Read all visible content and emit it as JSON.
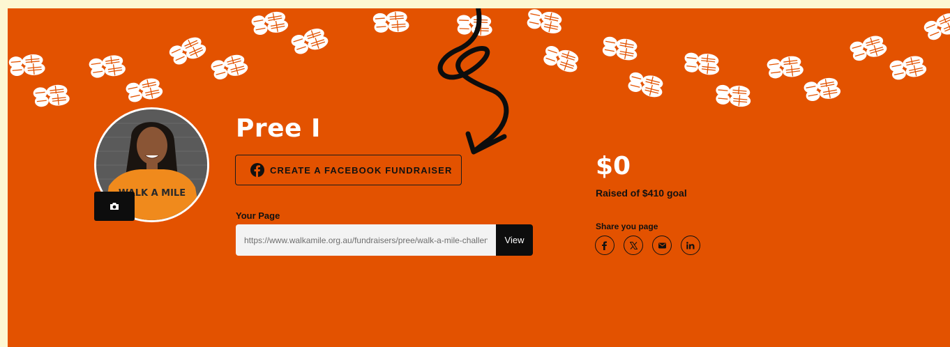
{
  "fundraiser": {
    "name": "Pree I",
    "facebook_button_label": "CREATE A FACEBOOK FUNDRAISER",
    "your_page_label": "Your Page",
    "page_url": "https://www.walkamile.org.au/fundraisers/pree/walk-a-mile-challenge",
    "view_label": "View",
    "amount_raised": "$0",
    "goal_text": "Raised of $410 goal",
    "share_label": "Share you page",
    "share_icons": [
      "facebook-icon",
      "x-icon",
      "email-icon",
      "linkedin-icon"
    ],
    "avatar_shirt_text": "WALK A MILE"
  },
  "colors": {
    "banner": "#e35200",
    "page_background": "#fdf7d2",
    "dark": "#0d0d0d",
    "field": "#f3f3f3"
  }
}
